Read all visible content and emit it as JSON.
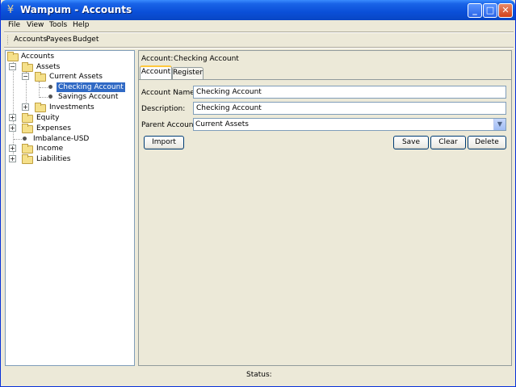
{
  "window": {
    "title": "Wampum - Accounts"
  },
  "menu": [
    "File",
    "View",
    "Tools",
    "Help"
  ],
  "toolbar": [
    "Accounts",
    "Payees",
    "Budget"
  ],
  "tree": {
    "root": "Accounts",
    "assets": "Assets",
    "current_assets": "Current Assets",
    "checking": "Checking Account",
    "savings": "Savings Account",
    "investments": "Investments",
    "equity": "Equity",
    "expenses": "Expenses",
    "imbalance": "Imbalance-USD",
    "income": "Income",
    "liabilities": "Liabilities"
  },
  "detail": {
    "header_label": "Account:",
    "header_value": "Checking Account",
    "tabs": [
      "Account",
      "Register"
    ],
    "account_name_label": "Account Name:",
    "account_name_value": "Checking Account",
    "description_label": "Description:",
    "description_value": "Checking Account",
    "parent_label": "Parent Account:",
    "parent_value": "Current Assets",
    "import_btn": "Import",
    "save_btn": "Save",
    "clear_btn": "Clear",
    "delete_btn": "Delete"
  },
  "status": "Status:"
}
